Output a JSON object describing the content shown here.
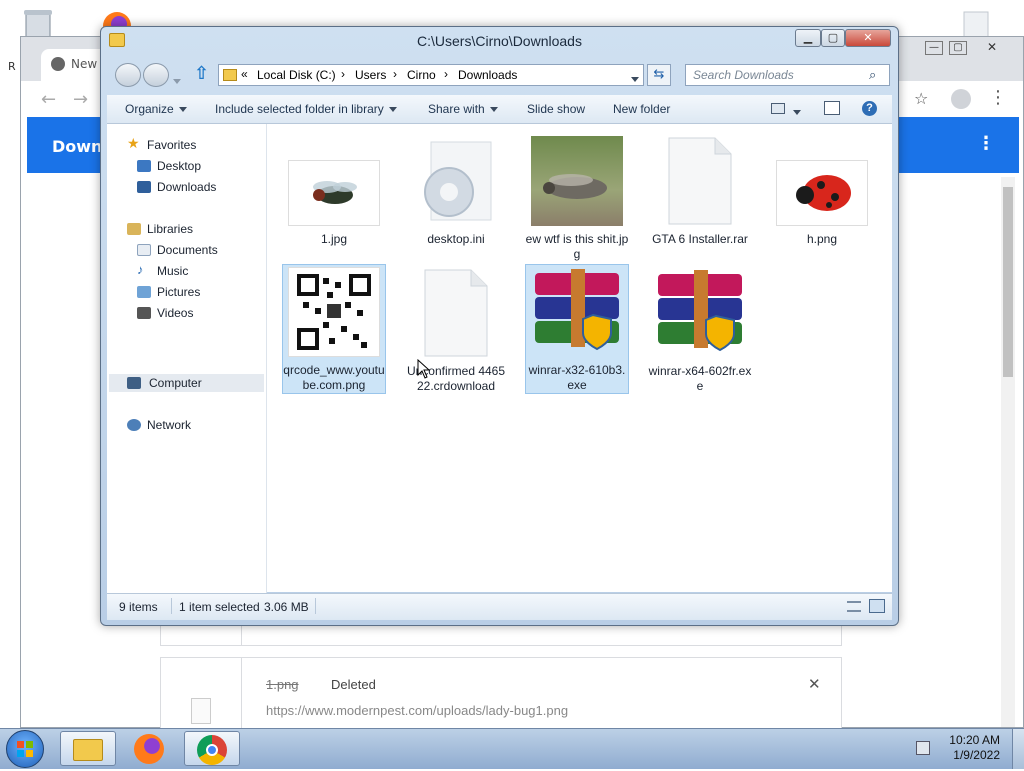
{
  "explorer": {
    "title": "C:\\Users\\Cirno\\Downloads",
    "breadcrumb": [
      "Local Disk (C:)",
      "Users",
      "Cirno",
      "Downloads"
    ],
    "breadcrumb_prefix": "«",
    "search_placeholder": "Search Downloads",
    "toolbar": {
      "organize": "Organize",
      "include": "Include selected folder in library",
      "share": "Share with",
      "slideshow": "Slide show",
      "newfolder": "New folder"
    },
    "nav": {
      "favorites": "Favorites",
      "desktop": "Desktop",
      "downloads": "Downloads",
      "libraries": "Libraries",
      "documents": "Documents",
      "music": "Music",
      "pictures": "Pictures",
      "videos": "Videos",
      "computer": "Computer",
      "network": "Network"
    },
    "files": [
      {
        "name": "1.jpg"
      },
      {
        "name": "desktop.ini"
      },
      {
        "name": "ew wtf is this shit.jpg"
      },
      {
        "name": "GTA 6 Installer.rar"
      },
      {
        "name": "h.png"
      },
      {
        "name": "qrcode_www.youtube.com.png"
      },
      {
        "name": "Unconfirmed 446522.crdownload"
      },
      {
        "name": "winrar-x32-610b3.exe"
      },
      {
        "name": "winrar-x64-602fr.exe"
      }
    ],
    "status": {
      "items": "9 items",
      "selected": "1 item selected",
      "size": "3.06 MB"
    }
  },
  "chrome": {
    "tab_label": "New",
    "page_header": "Downl",
    "download_item": {
      "filename": "1.png",
      "state": "Deleted",
      "url": "https://www.modernpest.com/uploads/lady-bug1.png"
    }
  },
  "desktop": {
    "recycle_label": "R"
  },
  "taskbar": {
    "time": "10:20 AM",
    "date": "1/9/2022"
  },
  "colors": {
    "chrome_blue": "#1a73e8",
    "selection": "#cce4f7",
    "taskbar": "#9fb8d8"
  }
}
